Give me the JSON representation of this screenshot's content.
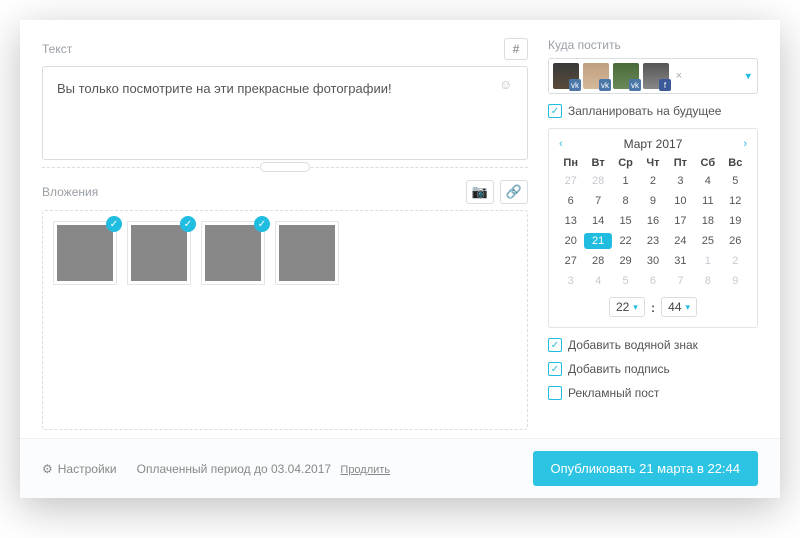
{
  "labels": {
    "text": "Текст",
    "attachments": "Вложения",
    "where": "Куда постить"
  },
  "compose": {
    "content": "Вы только посмотрите на эти прекрасные фотографии!"
  },
  "attachments": [
    {
      "checked": true
    },
    {
      "checked": true
    },
    {
      "checked": true
    },
    {
      "checked": false
    }
  ],
  "targets": [
    {
      "network": "vk"
    },
    {
      "network": "vk"
    },
    {
      "network": "vk"
    },
    {
      "network": "fb"
    }
  ],
  "schedule": {
    "checkbox_label": "Запланировать на будущее",
    "checked": true
  },
  "calendar": {
    "title": "Март 2017",
    "dow": [
      "Пн",
      "Вт",
      "Ср",
      "Чт",
      "Пт",
      "Сб",
      "Вс"
    ],
    "days": [
      {
        "n": 27,
        "muted": true
      },
      {
        "n": 28,
        "muted": true
      },
      {
        "n": 1
      },
      {
        "n": 2
      },
      {
        "n": 3
      },
      {
        "n": 4
      },
      {
        "n": 5
      },
      {
        "n": 6
      },
      {
        "n": 7
      },
      {
        "n": 8
      },
      {
        "n": 9
      },
      {
        "n": 10
      },
      {
        "n": 11
      },
      {
        "n": 12
      },
      {
        "n": 13
      },
      {
        "n": 14
      },
      {
        "n": 15
      },
      {
        "n": 16
      },
      {
        "n": 17
      },
      {
        "n": 18
      },
      {
        "n": 19
      },
      {
        "n": 20
      },
      {
        "n": 21,
        "selected": true
      },
      {
        "n": 22
      },
      {
        "n": 23
      },
      {
        "n": 24
      },
      {
        "n": 25
      },
      {
        "n": 26
      },
      {
        "n": 27
      },
      {
        "n": 28
      },
      {
        "n": 29
      },
      {
        "n": 30
      },
      {
        "n": 31
      },
      {
        "n": 1,
        "muted": true
      },
      {
        "n": 2,
        "muted": true
      },
      {
        "n": 3,
        "muted": true
      },
      {
        "n": 4,
        "muted": true
      },
      {
        "n": 5,
        "muted": true
      },
      {
        "n": 6,
        "muted": true
      },
      {
        "n": 7,
        "muted": true
      },
      {
        "n": 8,
        "muted": true
      },
      {
        "n": 9,
        "muted": true
      }
    ],
    "hour": "22",
    "minute": "44"
  },
  "options": {
    "watermark": {
      "label": "Добавить водяной знак",
      "checked": true
    },
    "caption": {
      "label": "Добавить подпись",
      "checked": true
    },
    "advert": {
      "label": "Рекламный пост",
      "checked": false
    }
  },
  "footer": {
    "settings": "Настройки",
    "paid_until": "Оплаченный период до 03.04.2017",
    "extend": "Продлить",
    "publish": "Опубликовать 21 марта в 22:44"
  },
  "icons": {
    "hash": "#",
    "camera": "📷",
    "link": "🔗",
    "gear": "⚙",
    "smiley": "☺",
    "check": "✓",
    "caret_down": "▾",
    "prev": "‹",
    "next": "›",
    "x": "×"
  }
}
